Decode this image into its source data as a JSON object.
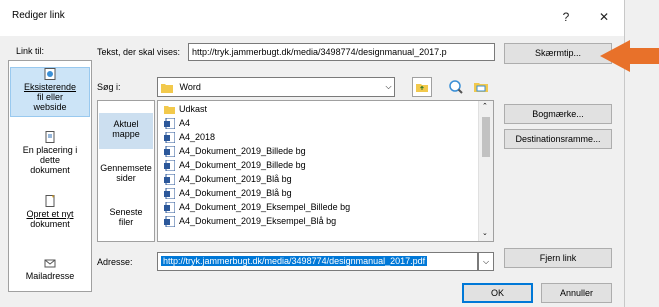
{
  "dialog": {
    "title": "Rediger link",
    "help_symbol": "?",
    "close_symbol": "✕"
  },
  "link_to_label": "Link til:",
  "linkbar": [
    {
      "label_line1": "Eksisterende",
      "label_line2": "fil eller",
      "label_line3": "webside",
      "icon": "globe-page-icon"
    },
    {
      "label_line1": "En placering i",
      "label_line2": "dette",
      "label_line3": "dokument",
      "icon": "document-place-icon"
    },
    {
      "label_line1": "Opret et nyt",
      "label_line2": "dokument",
      "label_line3": "",
      "icon": "new-document-icon"
    },
    {
      "label_line1": "Mailadresse",
      "label_line2": "",
      "label_line3": "",
      "icon": "mail-icon"
    }
  ],
  "text_to_display": {
    "label": "Tekst, der skal vises:",
    "value": "http://tryk.jammerbugt.dk/media/3498774/designmanual_2017.p"
  },
  "screentip_button": "Skærmtip...",
  "look_in": {
    "label": "Søg i:",
    "value": "Word"
  },
  "places": [
    {
      "line1": "Aktuel",
      "line2": "mappe"
    },
    {
      "line1": "Gennemsete",
      "line2": "sider"
    },
    {
      "line1": "Seneste",
      "line2": "filer"
    }
  ],
  "files": [
    {
      "name": "Udkast",
      "type": "folder"
    },
    {
      "name": "A4",
      "type": "word"
    },
    {
      "name": "A4_2018",
      "type": "word"
    },
    {
      "name": "A4_Dokument_2019_Billede bg",
      "type": "word"
    },
    {
      "name": "A4_Dokument_2019_Billede bg",
      "type": "word"
    },
    {
      "name": "A4_Dokument_2019_Blå bg",
      "type": "word"
    },
    {
      "name": "A4_Dokument_2019_Blå bg",
      "type": "word"
    },
    {
      "name": "A4_Dokument_2019_Eksempel_Billede bg",
      "type": "word"
    },
    {
      "name": "A4_Dokument_2019_Eksempel_Blå bg",
      "type": "word"
    }
  ],
  "right_buttons": {
    "bookmark": "Bogmærke...",
    "target_frame": "Destinationsramme...",
    "remove_link": "Fjern link"
  },
  "address": {
    "label": "Adresse:",
    "value": "http://tryk.jammerbugt.dk/media/3498774/designmanual_2017.pdf"
  },
  "footer": {
    "ok": "OK",
    "cancel": "Annuller"
  },
  "colors": {
    "accent_arrow": "#e8712a",
    "selection": "#cce4f7"
  }
}
